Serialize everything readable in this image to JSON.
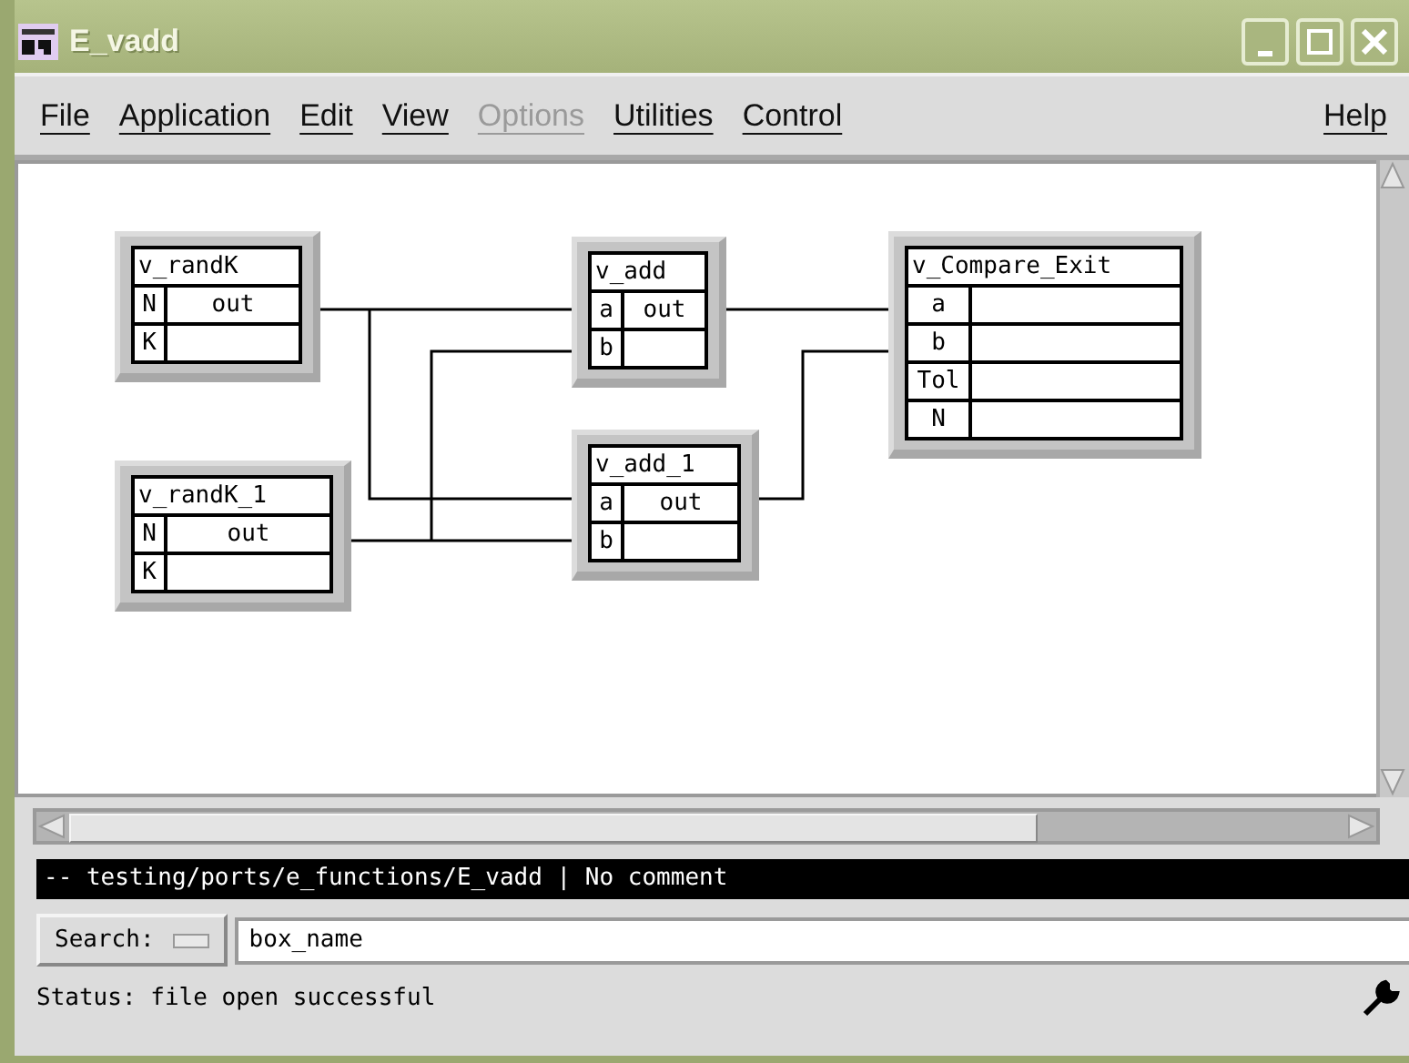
{
  "window": {
    "title": "E_vadd"
  },
  "menu": [
    {
      "label": "File",
      "disabled": false
    },
    {
      "label": "Application",
      "disabled": false
    },
    {
      "label": "Edit",
      "disabled": false
    },
    {
      "label": "View",
      "disabled": false
    },
    {
      "label": "Options",
      "disabled": true
    },
    {
      "label": "Utilities",
      "disabled": false
    },
    {
      "label": "Control",
      "disabled": false
    },
    {
      "label": "Help",
      "disabled": false
    }
  ],
  "boxes": [
    {
      "title": "v_randK",
      "rows": [
        {
          "input": "N",
          "output": "out"
        },
        {
          "input": "K"
        }
      ]
    },
    {
      "title": "v_add",
      "rows": [
        {
          "input": "a",
          "output": "out"
        },
        {
          "input": "b"
        }
      ]
    },
    {
      "title": "v_randK_1",
      "rows": [
        {
          "input": "N",
          "output": "out"
        },
        {
          "input": "K"
        }
      ]
    },
    {
      "title": "v_add_1",
      "rows": [
        {
          "input": "a",
          "output": "out"
        },
        {
          "input": "b"
        }
      ]
    },
    {
      "title": "v_Compare_Exit",
      "rows": [
        {
          "input": "a"
        },
        {
          "input": "b"
        },
        {
          "input": "Tol"
        },
        {
          "input": "N"
        }
      ]
    }
  ],
  "path_bar": "-- testing/ports/e_functions/E_vadd | No comment",
  "search": {
    "label": "Search:",
    "value": "box_name"
  },
  "status": "Status: file open successful"
}
